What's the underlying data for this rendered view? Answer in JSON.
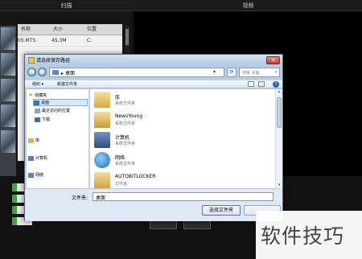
{
  "app": {
    "tabs": [
      "扫描",
      "视频"
    ],
    "table_headers": [
      "名称",
      "大小",
      "位置"
    ],
    "table_rows": [
      {
        "name": "05.MTS",
        "size": "45.3M",
        "location": "C:"
      }
    ],
    "bottom_buttons": [
      "",
      ""
    ]
  },
  "dialog": {
    "title": "请选择保存路径",
    "close_symbol": "✕",
    "nav": {
      "back": "◀",
      "forward": "▶"
    },
    "address": {
      "current": "桌面",
      "separator": "▸",
      "dropdown": "▾"
    },
    "refresh_symbol": "⟳",
    "search": {
      "placeholder": "搜索 桌面",
      "icon": "⌕"
    },
    "toolbar": {
      "organize": "组织 ▾",
      "new_folder": "新建文件夹",
      "help": "?"
    },
    "sidebar": {
      "favorites": "收藏夹",
      "items": [
        "桌面",
        "最近访问的位置",
        "下载"
      ],
      "library": "库",
      "computer": "计算机",
      "network": "网络"
    },
    "content_items": [
      {
        "name": "库",
        "type": "系统文件夹"
      },
      {
        "name": "NewsYoung",
        "type": "系统文件夹"
      },
      {
        "name": "计算机",
        "type": "系统文件夹"
      },
      {
        "name": "网络",
        "type": "系统文件夹"
      },
      {
        "name": "AUTOBITLOCKER",
        "type": "文件夹"
      }
    ],
    "folder_label": "文件夹:",
    "folder_value": "桌面",
    "select_button": "选择文件夹",
    "cancel_button": ""
  },
  "watermark": {
    "text": "软件技巧"
  },
  "colors": {
    "accent_blue": "#2d63b5",
    "window_frame": "#b9cfe4",
    "status_green": "#3fa53a"
  }
}
